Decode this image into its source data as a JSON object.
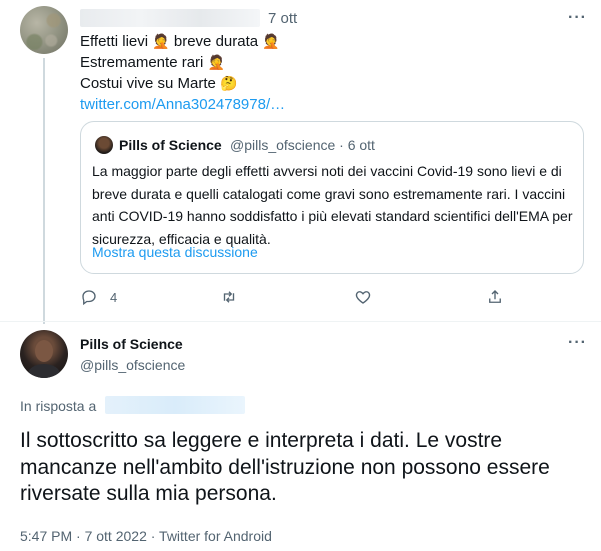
{
  "first_tweet": {
    "time": "7 ott",
    "lines": [
      {
        "text": "Effetti lievi",
        "emoji": "🤦",
        "text2": "breve durata",
        "emoji2": "🤦"
      },
      {
        "text": "Estremamente rari",
        "emoji": "🤦"
      },
      {
        "text": "Costui vive su Marte",
        "emoji": "🤔"
      }
    ],
    "link": "twitter.com/Anna302478978/…",
    "replies_count": "4",
    "quote": {
      "name": "Pills of Science",
      "handle_time": "@pills_ofscience · 6 ott",
      "body": "La maggior parte degli effetti avversi noti dei vaccini Covid-19 sono lievi e di breve durata e quelli catalogati come gravi sono estremamente rari. I vaccini anti COVID-19 hanno soddisfatto i più elevati standard scientifici dell'EMA per sicurezza, efficacia e qualità.",
      "show_thread": "Mostra questa discussione"
    }
  },
  "main_tweet": {
    "name": "Pills of Science",
    "handle": "@pills_ofscience",
    "reply_to_label": "In risposta a",
    "text": "Il sottoscritto sa leggere e interpreta i dati. Le vostre mancanze nell'ambito dell'istruzione non possono essere riversate sulla mia persona.",
    "meta": "5:47 PM · 7 ott 2022 · Twitter for Android"
  },
  "icons": {
    "more": "more-horizontal-icon",
    "reply": "reply-icon",
    "retweet": "retweet-icon",
    "like": "heart-icon",
    "share": "share-icon"
  },
  "colors": {
    "accent": "#1d9bf0",
    "secondary_text": "#536471",
    "border": "#cfd9de"
  }
}
